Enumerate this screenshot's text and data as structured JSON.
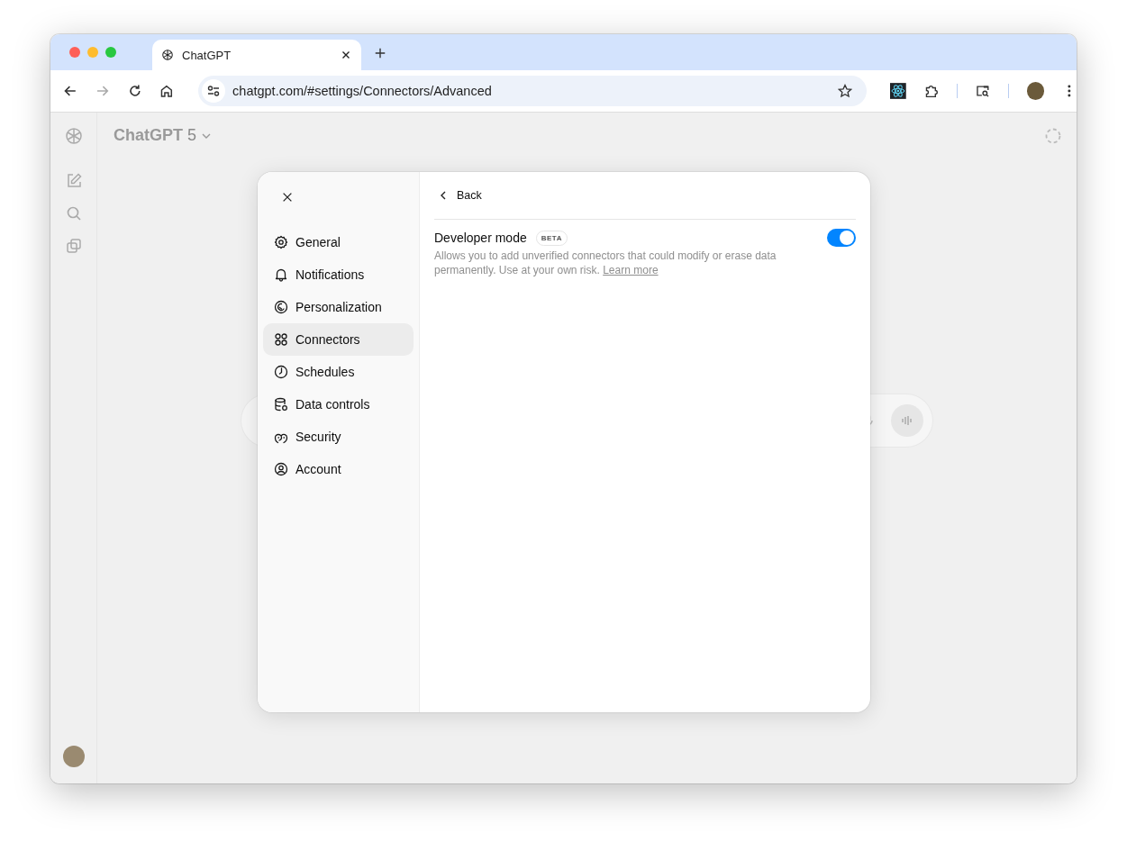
{
  "browser": {
    "tab": {
      "title": "ChatGPT"
    },
    "address": "chatgpt.com/#settings/Connectors/Advanced"
  },
  "app": {
    "model": {
      "name": "ChatGPT",
      "version": "5"
    }
  },
  "settings": {
    "nav": [
      {
        "label": "General",
        "selected": false
      },
      {
        "label": "Notifications",
        "selected": false
      },
      {
        "label": "Personalization",
        "selected": false
      },
      {
        "label": "Connectors",
        "selected": true
      },
      {
        "label": "Schedules",
        "selected": false
      },
      {
        "label": "Data controls",
        "selected": false
      },
      {
        "label": "Security",
        "selected": false
      },
      {
        "label": "Account",
        "selected": false
      }
    ],
    "back": "Back",
    "setting": {
      "title": "Developer mode",
      "badge": "BETA",
      "on": true,
      "description": "Allows you to add unverified connectors that could modify or erase data permanently. Use at your own risk.",
      "link": "Learn more"
    }
  }
}
